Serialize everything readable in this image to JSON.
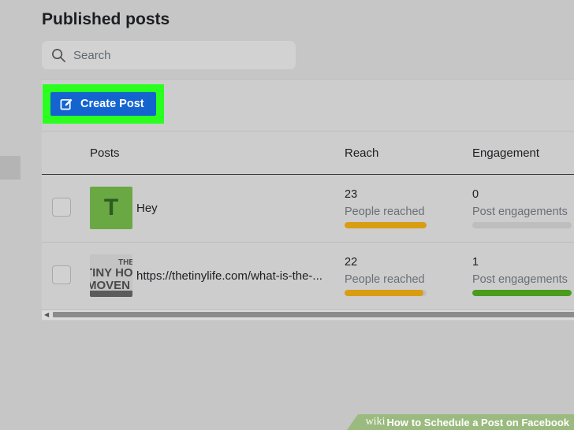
{
  "page": {
    "title": "Published posts"
  },
  "search": {
    "placeholder": "Search"
  },
  "toolbar": {
    "create_post_label": "Create Post"
  },
  "table": {
    "columns": [
      "Posts",
      "Reach",
      "Engagement"
    ],
    "rows": [
      {
        "thumbnail": "T",
        "text": "Hey",
        "reach": "23",
        "reach_label": "People reached",
        "reach_bar_fraction": 1.0,
        "engagement": "0",
        "engagement_label": "Post engagements",
        "engagement_bar_fraction": 0
      },
      {
        "thumbnail_text": [
          "THE",
          "TINY HO",
          "MOVEN"
        ],
        "text": "https://thetinylife.com/what-is-the-...",
        "reach": "22",
        "reach_label": "People reached",
        "reach_bar_fraction": 0.96,
        "engagement": "1",
        "engagement_label": "Post engagements",
        "engagement_bar_fraction": 1.0
      }
    ]
  },
  "colors": {
    "highlight": "#2aff1f",
    "button": "#1464d0",
    "reach_bar": "#d89d13",
    "engagement_bar": "#4a9c1e"
  },
  "watermark": {
    "wiki": "wiki",
    "how": "How",
    "rest": "to Schedule a Post on Facebook"
  }
}
